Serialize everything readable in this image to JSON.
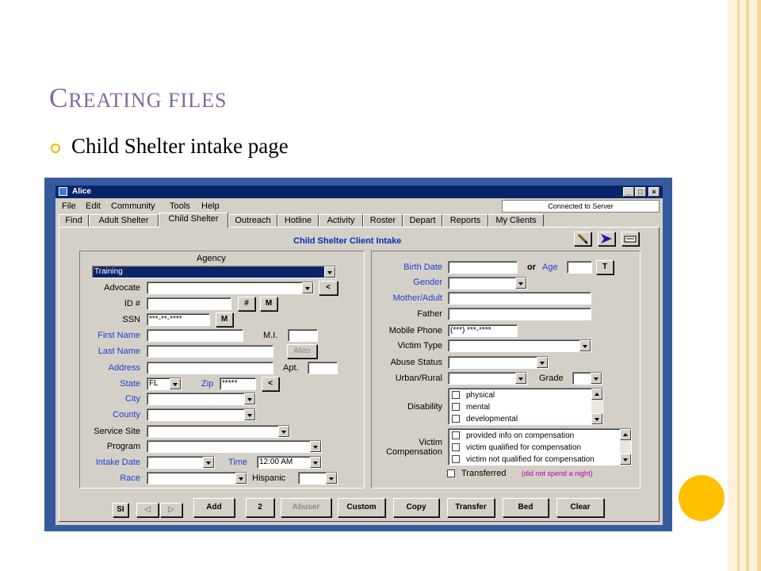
{
  "slide": {
    "title_cap": "C",
    "title_rest": "REATING FILES",
    "bullet": "Child Shelter intake page"
  },
  "colors": {
    "title": "#8465a0",
    "accent": "#ffc000",
    "window_frame": "#355b9d",
    "field_label_blue": "#1e3fd0",
    "form_title": "#0a2fb0"
  },
  "window": {
    "title": "Alice",
    "controls": [
      "_",
      "□",
      "×"
    ],
    "menu": [
      "File",
      "Edit",
      "Community",
      "Tools",
      "Help"
    ],
    "status": "Connected to Server",
    "tabs": [
      "Find",
      "Adult Shelter",
      "Child Shelter",
      "Outreach",
      "Hotline",
      "Activity",
      "Roster",
      "Depart",
      "Reports",
      "My Clients"
    ],
    "active_tab": "Child Shelter"
  },
  "form": {
    "title": "Child Shelter Client Intake",
    "toolbar_icons": [
      "pencil-icon",
      "arrow-right-icon",
      "card-icon"
    ],
    "left": {
      "agency_label": "Agency",
      "agency_value": "Training",
      "advocate_label": "Advocate",
      "advocate_btn": "<",
      "id_label": "ID #",
      "id_btn_hash": "#",
      "id_btn_m": "M",
      "ssn_label": "SSN",
      "ssn_value": "***-**-****",
      "ssn_btn": "M",
      "first_name_label": "First Name",
      "mi_label": "M.I.",
      "last_name_label": "Last Name",
      "alias_btn": "Alias",
      "address_label": "Address",
      "apt_label": "Apt.",
      "state_label": "State",
      "state_value": "FL",
      "zip_label": "Zip",
      "zip_value": "*****",
      "zip_btn": "<",
      "city_label": "City",
      "county_label": "County",
      "service_site_label": "Service Site",
      "program_label": "Program",
      "intake_date_label": "Intake Date",
      "time_label": "Time",
      "time_value": "12:00 AM",
      "race_label": "Race",
      "hispanic_label": "Hispanic"
    },
    "right": {
      "birth_date_label": "Birth Date",
      "or_label": "or",
      "age_label": "Age",
      "age_btn": "T",
      "gender_label": "Gender",
      "mother_label": "Mother/Adult",
      "father_label": "Father",
      "mobile_label": "Mobile Phone",
      "mobile_value": "(***) ***-****",
      "victim_type_label": "Victim Type",
      "abuse_status_label": "Abuse Status",
      "urban_label": "Urban/Rural",
      "grade_label": "Grade",
      "disability_label": "Disability",
      "disability_items": [
        "physical",
        "mental",
        "developmental"
      ],
      "victim_comp_label_1": "Victim",
      "victim_comp_label_2": "Compensation",
      "victim_comp_items": [
        "provided info on compensation",
        "victim qualified for compensation",
        "victim not qualified for compensation"
      ],
      "transferred_label": "Transferred",
      "transferred_note": "(did not spend a night)"
    }
  },
  "bottom_bar": {
    "si": "SI",
    "prev": "◁",
    "next": "▷",
    "buttons": [
      "Add",
      "2",
      "Abuser",
      "Custom",
      "Copy",
      "Transfer",
      "Bed",
      "Clear"
    ]
  }
}
